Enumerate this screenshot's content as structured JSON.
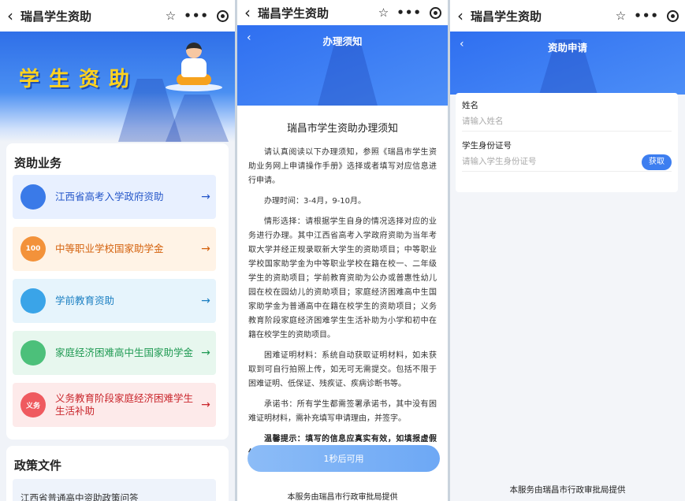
{
  "app_title": "瑞昌学生资助",
  "panel1": {
    "banner_text": "学生资助",
    "section_title": "资助业务",
    "items": [
      {
        "label": "江西省高考入学政府资助",
        "icon_text": "",
        "bg": "#e8f0ff",
        "text_color": "#2456c9",
        "icon_color": "#3a7ae8"
      },
      {
        "label": "中等职业学校国家助学金",
        "icon_text": "100",
        "bg": "#fff3e6",
        "text_color": "#d4620e",
        "icon_color": "#f3923a"
      },
      {
        "label": "学前教育资助",
        "icon_text": "",
        "bg": "#e6f4fc",
        "text_color": "#1b7fc2",
        "icon_color": "#3aa4e8"
      },
      {
        "label": "家庭经济困难高中生国家助学金",
        "icon_text": "",
        "bg": "#e7f7ee",
        "text_color": "#1f9a53",
        "icon_color": "#4cc07a"
      },
      {
        "label": "义务教育阶段家庭经济困难学生生活补助",
        "icon_text": "义务",
        "bg": "#fdeaea",
        "text_color": "#c9262c",
        "icon_color": "#ef5a5f"
      }
    ],
    "policy_title": "政策文件",
    "policy_items": [
      "江西省普通高中资助政策问答"
    ]
  },
  "panel2": {
    "header_title": "办理须知",
    "doc_title": "瑞昌市学生资助办理须知",
    "paragraphs": [
      "请认真阅读以下办理须知，参照《瑞昌市学生资助业务网上申请操作手册》选择或者填写对应信息进行申请。",
      "办理时间：3-4月，9-10月。",
      "情形选择：请根据学生自身的情况选择对应的业务进行办理。其中江西省高考入学政府资助为当年考取大学并经正规录取新大学生的资助项目；中等职业学校国家助学金为中等职业学校在籍在校一、二年级学生的资助项目；学前教育资助为公办或普惠性幼儿园在校在园幼儿的资助项目；家庭经济困难高中生国家助学金为普通高中在籍在校学生的资助项目；义务教育阶段家庭经济困难学生生活补助为小学和初中在籍在校学生的资助项目。",
      "困难证明材料：系统自动获取证明材料，如未获取到可自行拍照上传，如无可无需提交。包括不限于困难证明、低保证、残疾证、疾病诊断书等。",
      "承诺书：所有学生都需签署承诺书，其中没有困难证明材料，需补充填写申请理由，并签字。"
    ],
    "warning": "温馨提示：填写的信息应真实有效，如填报虚假信息，将自行承担相应的法律责任。",
    "wait_button": "1秒后可用",
    "footer": "本服务由瑞昌市行政审批局提供"
  },
  "panel3": {
    "header_title": "资助申请",
    "name_label": "姓名",
    "name_placeholder": "请输入姓名",
    "id_label": "学生身份证号",
    "id_placeholder": "请输入学生身份证号",
    "get_button": "获取",
    "footer": "本服务由瑞昌市行政审批局提供"
  }
}
